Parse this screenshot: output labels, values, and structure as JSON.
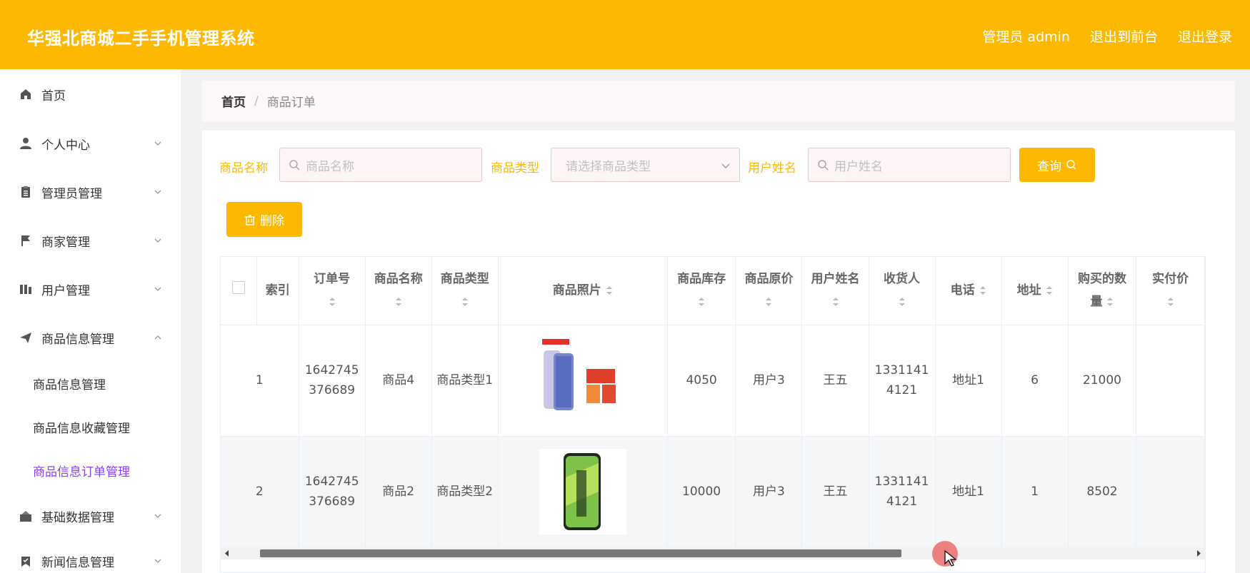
{
  "header": {
    "title": "华强北商城二手手机管理系统",
    "admin": "管理员 admin",
    "to_front": "退出到前台",
    "logout": "退出登录",
    "bg_color": "#fdb902"
  },
  "sidebar": {
    "items": [
      {
        "label": "首页",
        "icon": "home-icon"
      },
      {
        "label": "个人中心",
        "icon": "user-icon"
      },
      {
        "label": "管理员管理",
        "icon": "clipboard-icon"
      },
      {
        "label": "商家管理",
        "icon": "flag-icon"
      },
      {
        "label": "用户管理",
        "icon": "columns-icon"
      },
      {
        "label": "商品信息管理",
        "icon": "send-icon",
        "expanded": true
      },
      {
        "label": "基础数据管理",
        "icon": "box-icon"
      },
      {
        "label": "新闻信息管理",
        "icon": "badge-icon"
      }
    ],
    "sub_items": [
      {
        "label": "商品信息管理"
      },
      {
        "label": "商品信息收藏管理"
      },
      {
        "label": "商品信息订单管理",
        "active": true
      }
    ],
    "active_color": "#8a3ffc"
  },
  "breadcrumb": {
    "home": "首页",
    "separator": "/",
    "current": "商品订单"
  },
  "search": {
    "name_label": "商品名称",
    "name_placeholder": "商品名称",
    "type_label": "商品类型",
    "type_placeholder": "请选择商品类型",
    "user_label": "用户姓名",
    "user_placeholder": "用户姓名",
    "query_button": "查询"
  },
  "actions": {
    "delete_button": "删除"
  },
  "table": {
    "headers": {
      "index": "索引",
      "order_no": "订单号",
      "product_name": "商品名称",
      "product_type": "商品类型",
      "photo": "商品照片",
      "stock": "商品库存",
      "orig_price": "商品原价",
      "user_name": "用户姓名",
      "receiver": "收货人",
      "phone": "电话",
      "address": "地址",
      "quantity": "购买的数量",
      "paid": "实付价"
    },
    "rows": [
      {
        "index": "1",
        "order_no": "1642745376689",
        "product_name": "商品4",
        "product_type": "商品类型1",
        "photo": "oneplus-9-phone-image",
        "stock": "4050",
        "user_name": "用户3",
        "receiver": "王五",
        "phone": "13311414121",
        "address": "地址1",
        "quantity": "6",
        "paid": "21000"
      },
      {
        "index": "2",
        "order_no": "1642745376689",
        "product_name": "商品2",
        "product_type": "商品类型2",
        "photo": "realme-gt-neo2-phone-image",
        "stock": "10000",
        "user_name": "用户3",
        "receiver": "王五",
        "phone": "13311414121",
        "address": "地址1",
        "quantity": "1",
        "paid": "8502"
      }
    ]
  }
}
